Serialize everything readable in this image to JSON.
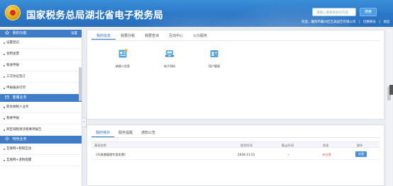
{
  "header": {
    "title": "国家税务总局湖北省电子税务局",
    "search_placeholder": "请输入需要搜索的内容",
    "search_button": "搜索",
    "welcome": "欢迎，襄阳市襄州区吉美园艺有限公司",
    "links": [
      "|",
      "切换税号",
      "|",
      "退出"
    ],
    "brand_color": "#2b77c7"
  },
  "sidebar": {
    "sections": [
      {
        "title": "我的功能",
        "more": "设置",
        "icon": "star-icon",
        "items": [
          "设置登记",
          "领用发票",
          "税收申报",
          "三方协议签订",
          "申报报表打印"
        ]
      },
      {
        "title": "套餐业务",
        "icon": "package-icon",
        "items": [
          "新办纳税人业务",
          "我要申报",
          "跨区域税源涉税事项报告"
        ]
      },
      {
        "title": "特色业务",
        "icon": "feature-icon",
        "items": [
          "互联网+税银互动",
          "互联网+退税提醒"
        ]
      }
    ]
  },
  "top_panel": {
    "tabs": [
      "我的信息",
      "我要办税",
      "我要查询",
      "互动中心",
      "公众服务"
    ],
    "active_tab": 0,
    "apps": [
      {
        "label": "纳税人信息",
        "icon": "taxpayer-info-icon",
        "color": "#4fa6e6"
      },
      {
        "label": "电子资料",
        "icon": "electronic-documents-icon",
        "color": "#4fa6e6"
      },
      {
        "label": "用户管理",
        "icon": "user-management-icon",
        "color": "#4fa6e6"
      }
    ]
  },
  "bottom_panel": {
    "tabs": [
      "我的待办",
      "服务提醒",
      "通知公告"
    ],
    "active_tab": 0,
    "columns": [
      "事项名称",
      "提交时间",
      "截止时间",
      "状态",
      "操作"
    ],
    "rows": [
      {
        "name": "《开具增值税专用发票》",
        "submitted": "2018-11-21",
        "deadline": "--",
        "status": "未办理",
        "action": "办理"
      }
    ]
  }
}
